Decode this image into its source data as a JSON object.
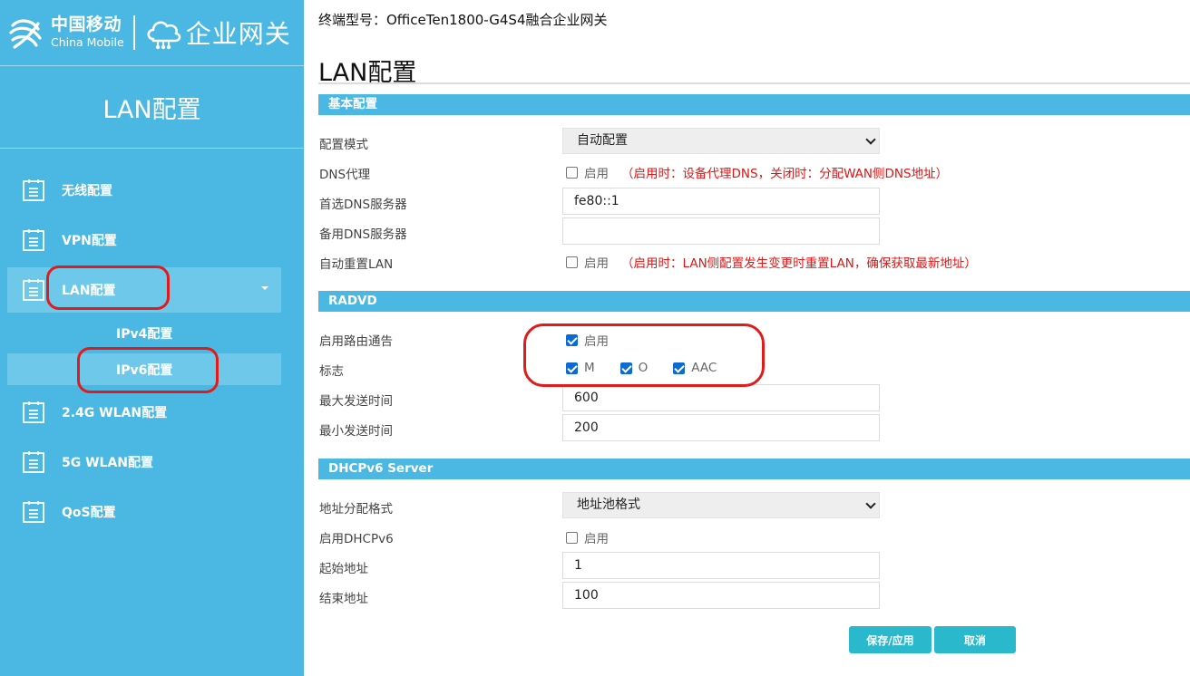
{
  "brand": {
    "cn": "中国移动",
    "en": "China Mobile",
    "product": "企业网关"
  },
  "sidebar": {
    "title": "LAN配置",
    "items": [
      {
        "label": "无线配置"
      },
      {
        "label": "VPN配置"
      },
      {
        "label": "LAN配置"
      },
      {
        "label": "2.4G WLAN配置"
      },
      {
        "label": "5G WLAN配置"
      },
      {
        "label": "QoS配置"
      }
    ],
    "sub_items": [
      {
        "label": "IPv4配置"
      },
      {
        "label": "IPv6配置"
      }
    ]
  },
  "device_line": "终端型号：OfficeTen1800-G4S4融合企业网关",
  "page_title": "LAN配置",
  "basic": {
    "header": "基本配置",
    "mode_label": "配置模式",
    "mode_value": "自动配置",
    "dns_proxy_label": "DNS代理",
    "dns_proxy_cb": "启用",
    "dns_proxy_note": "（启用时：设备代理DNS，关闭时：分配WAN侧DNS地址）",
    "primary_dns_label": "首选DNS服务器",
    "primary_dns_value": "fe80::1",
    "secondary_dns_label": "备用DNS服务器",
    "secondary_dns_value": "",
    "auto_reset_label": "自动重置LAN",
    "auto_reset_cb": "启用",
    "auto_reset_note": "（启用时：LAN侧配置发生变更时重置LAN，确保获取最新地址）"
  },
  "radvd": {
    "header": "RADVD",
    "enable_label": "启用路由通告",
    "enable_cb": "启用",
    "flags_label": "标志",
    "flag_m": "M",
    "flag_o": "O",
    "flag_aac": "AAC",
    "max_label": "最大发送时间",
    "max_value": "600",
    "min_label": "最小发送时间",
    "min_value": "200"
  },
  "dhcpv6": {
    "header": "DHCPv6 Server",
    "format_label": "地址分配格式",
    "format_value": "地址池格式",
    "enable_label": "启用DHCPv6",
    "enable_cb": "启用",
    "start_label": "起始地址",
    "start_value": "1",
    "end_label": "结束地址",
    "end_value": "100"
  },
  "buttons": {
    "save": "保存/应用",
    "cancel": "取消"
  },
  "state": {
    "dns_proxy": false,
    "auto_reset": false,
    "radvd_enable": true,
    "flag_m": true,
    "flag_o": true,
    "flag_aac": true,
    "dhcpv6_enable": false
  },
  "colors": {
    "sidebar_bg": "#4ab8e2",
    "active_item": "#6ec8ea",
    "section_bar": "#4ab8e2",
    "note_red": "#e01515",
    "button": "#29b8cc",
    "highlight_ring": "#e11b1b"
  }
}
